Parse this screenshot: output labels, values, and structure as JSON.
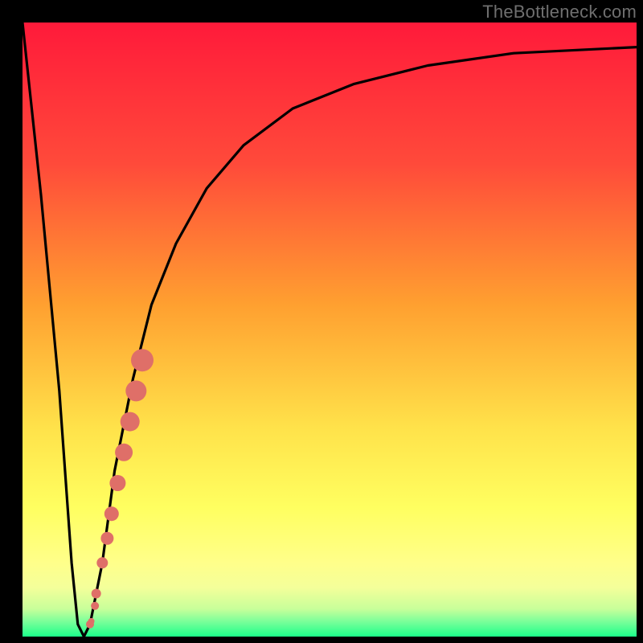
{
  "watermark": "TheBottleneck.com",
  "colors": {
    "frame": "#000000",
    "curve": "#000000",
    "blob": "#df6f68",
    "gradient_stops": [
      {
        "offset": 0.0,
        "color": "#ff1a3a"
      },
      {
        "offset": 0.23,
        "color": "#ff4a3a"
      },
      {
        "offset": 0.46,
        "color": "#ffa030"
      },
      {
        "offset": 0.66,
        "color": "#ffe24a"
      },
      {
        "offset": 0.79,
        "color": "#ffff60"
      },
      {
        "offset": 0.88,
        "color": "#ffff8a"
      },
      {
        "offset": 0.92,
        "color": "#f4ff9a"
      },
      {
        "offset": 0.955,
        "color": "#c8ff9a"
      },
      {
        "offset": 0.975,
        "color": "#7cff9a"
      },
      {
        "offset": 1.0,
        "color": "#1cff8a"
      }
    ]
  },
  "chart_data": {
    "type": "line",
    "title": "",
    "xlabel": "",
    "ylabel": "",
    "xlim": [
      0,
      100
    ],
    "ylim": [
      0,
      100
    ],
    "grid": false,
    "legend": false,
    "series": [
      {
        "name": "bottleneck_curve",
        "x": [
          0,
          3,
          6,
          8,
          9,
          10,
          11,
          13,
          15,
          18,
          21,
          25,
          30,
          36,
          44,
          54,
          66,
          80,
          100
        ],
        "y": [
          100,
          72,
          40,
          12,
          2,
          0,
          2,
          12,
          27,
          42,
          54,
          64,
          73,
          80,
          86,
          90,
          93,
          95,
          96
        ]
      }
    ],
    "annotations": [
      {
        "name": "highlight_blob",
        "type": "points",
        "points_xy": [
          [
            11.0,
            2.0
          ],
          [
            12.0,
            7.0
          ],
          [
            13.0,
            12.0
          ],
          [
            13.8,
            16.0
          ],
          [
            14.5,
            20.0
          ],
          [
            15.5,
            25.0
          ],
          [
            16.5,
            30.0
          ],
          [
            17.5,
            35.0
          ],
          [
            18.5,
            40.0
          ],
          [
            19.5,
            45.0
          ]
        ]
      }
    ]
  }
}
